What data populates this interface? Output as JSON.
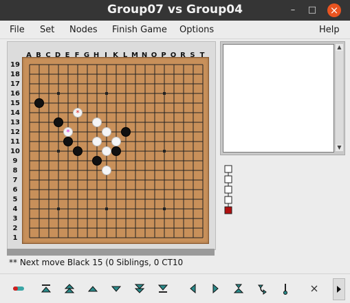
{
  "window": {
    "title": "Group07 vs Group04",
    "close_glyph": "×",
    "minimize_glyph": "–",
    "maximize_glyph": "□"
  },
  "menu": [
    "File",
    "Set",
    "Nodes",
    "Finish Game",
    "Options",
    "Help"
  ],
  "board": {
    "size": 19,
    "columns": [
      "A",
      "B",
      "C",
      "D",
      "E",
      "F",
      "G",
      "H",
      "J",
      "K",
      "L",
      "M",
      "N",
      "O",
      "P",
      "Q",
      "R",
      "S",
      "T"
    ],
    "rows": [
      "19",
      "18",
      "17",
      "16",
      "15",
      "14",
      "13",
      "12",
      "11",
      "10",
      "9",
      "8",
      "7",
      "6",
      "5",
      "4",
      "3",
      "2",
      "1"
    ],
    "star_points": [
      "D16",
      "J16",
      "P16",
      "D10",
      "J10",
      "P10",
      "D4",
      "J4",
      "P4"
    ],
    "black_stones": [
      "B15",
      "D13",
      "L12",
      "E11",
      "F10",
      "K10",
      "H9"
    ],
    "white_stones": [
      "H13",
      "J12",
      "H11",
      "K11",
      "J10",
      "J8"
    ],
    "marked_stones": [
      {
        "point": "F14",
        "color": "white",
        "mark": "red-star"
      },
      {
        "point": "E12",
        "color": "white",
        "mark": "magenta-star"
      }
    ],
    "colors": {
      "wood": "#c8905a",
      "line": "#222222",
      "black_stone": "#111111",
      "white_stone": "#f5f5f5",
      "red_mark": "#d82020",
      "magenta_mark": "#d020d0"
    }
  },
  "status_text": "** Next move  Black 15 (0 Siblings, 0 CT10",
  "game_tree": {
    "nodes": 4,
    "current_color": "#b01010"
  },
  "toolbar": [
    "battery-icon",
    "goto-start-icon",
    "back-10-icon",
    "back-icon",
    "forward-icon",
    "forward-10-icon",
    "goto-end-icon",
    "prev-variation-icon",
    "next-variation-icon",
    "main-branch-icon",
    "branch-start-icon",
    "mark-icon",
    "close-x-icon",
    "scroll-right-icon"
  ]
}
